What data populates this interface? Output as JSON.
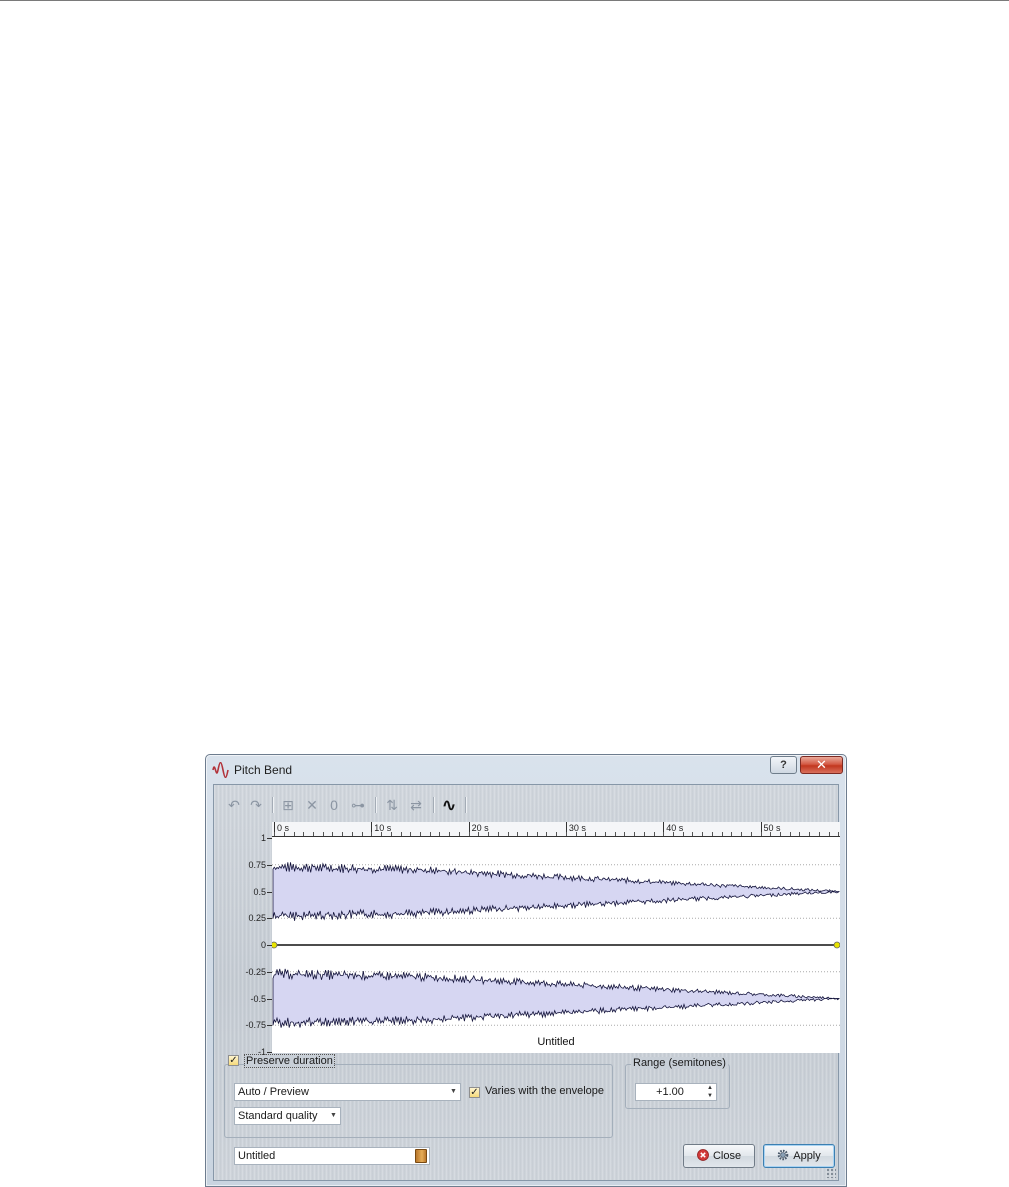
{
  "window": {
    "title": "Pitch Bend",
    "help_label": "?",
    "close_glyph": "✕"
  },
  "toolbar": {
    "buttons": [
      {
        "icon": "undo-icon",
        "glyph": "↶"
      },
      {
        "icon": "redo-icon",
        "glyph": "↷"
      },
      {
        "icon": "add-point-icon",
        "glyph": "⊞"
      },
      {
        "icon": "delete-point-icon",
        "glyph": "✕"
      },
      {
        "icon": "reset-zero-icon",
        "glyph": "0"
      },
      {
        "icon": "link-points-icon",
        "glyph": "⊶"
      },
      {
        "icon": "flip-vertical-icon",
        "glyph": "⇅"
      },
      {
        "icon": "swap-horizontal-icon",
        "glyph": "⇄"
      },
      {
        "icon": "curve-smooth-icon",
        "glyph": "∿"
      }
    ]
  },
  "envelope": {
    "ruler_labels": [
      "0 s",
      "10 s",
      "20 s",
      "30 s",
      "40 s",
      "50 s"
    ],
    "y_labels": [
      "1",
      "0.75",
      "0.5",
      "0.25",
      "0",
      "-0.25",
      "-0.5",
      "-0.75",
      "-1"
    ],
    "wave_title": "Untitled",
    "envelope_value": 0,
    "colors": {
      "wave_fill": "#d6d6f2",
      "wave_stroke": "#14143c",
      "point": "#e8e400"
    }
  },
  "options": {
    "preserve_duration": {
      "label": "Preserve duration",
      "checked": true
    },
    "mode_select": "Auto / Preview",
    "varies": {
      "label": "Varies with the envelope",
      "checked": true
    },
    "quality_select": "Standard quality"
  },
  "range": {
    "legend": "Range (semitones)",
    "value": "+1.00"
  },
  "footer": {
    "preset_name": "Untitled",
    "close_label": "Close",
    "apply_label": "Apply"
  }
}
